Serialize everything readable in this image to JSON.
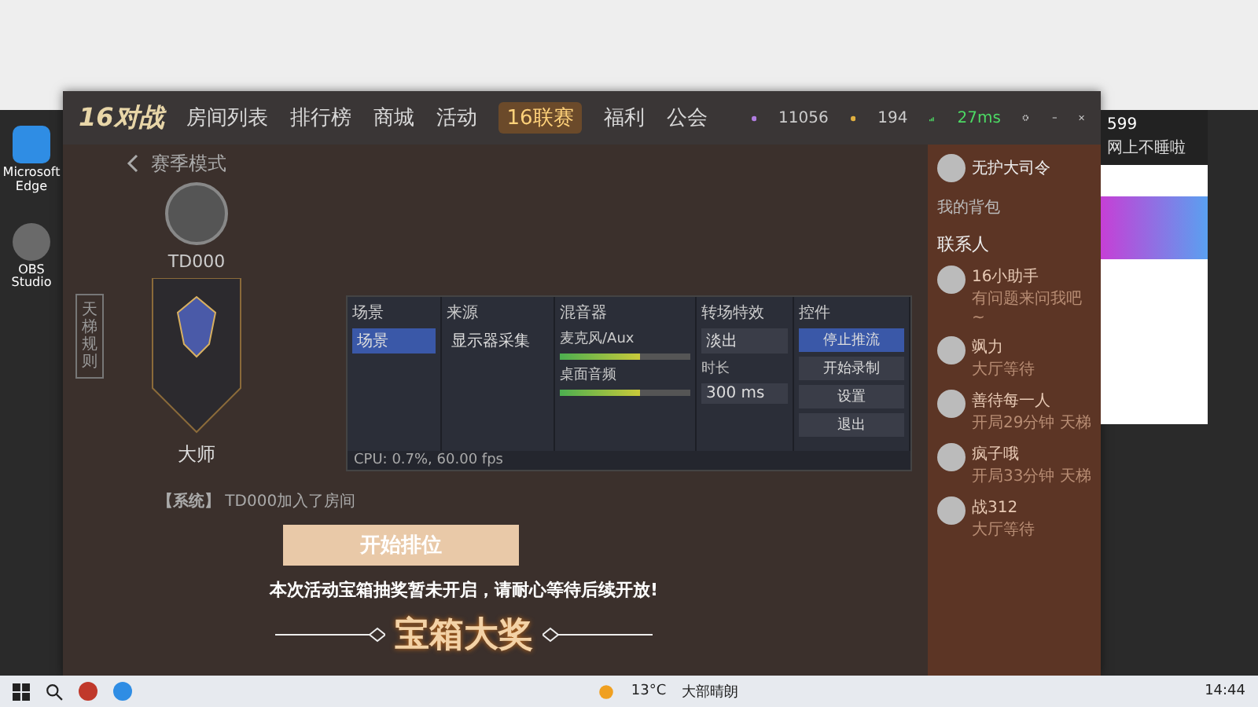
{
  "desktop_icons": [
    {
      "label": "Microsoft Edge",
      "kind": "browser"
    },
    {
      "label": "OBS Studio",
      "kind": "recorder"
    }
  ],
  "game_window": {
    "logo": "16对战",
    "nav": [
      {
        "label": "房间列表",
        "selected": false
      },
      {
        "label": "排行榜",
        "selected": false
      },
      {
        "label": "商城",
        "selected": false
      },
      {
        "label": "活动",
        "selected": false
      },
      {
        "label": "16联赛",
        "selected": true
      },
      {
        "label": "福利",
        "selected": false
      },
      {
        "label": "公会",
        "selected": false
      }
    ],
    "gems": "11056",
    "coins": "194",
    "ping": "27ms",
    "mode_title": "赛季模式",
    "side_tab": "天梯规则",
    "player": {
      "name": "TD000",
      "rank": "大师"
    },
    "system_message": "**【系统】** TD000加入了房间",
    "start_button": "开始排位",
    "notice": "本次活动宝箱抽奖暂未开启，请耐心等待后续开放!",
    "banner": "宝箱大奖",
    "profile": {
      "name": "无护大司令"
    },
    "backpack": "我的背包",
    "contacts_title": "联系人",
    "friends": [
      {
        "name": "16小助手",
        "status": "有问题来问我吧~"
      },
      {
        "name": "飒力",
        "status": "大厅等待"
      },
      {
        "name": "善待每一人",
        "status": "开局29分钟 天梯"
      },
      {
        "name": "疯子哦",
        "status": "开局33分钟 天梯"
      },
      {
        "name": "战312",
        "status": "大厅等待"
      }
    ]
  },
  "obs": {
    "scenes": {
      "title": "场景",
      "items": [
        {
          "label": "场景",
          "selected": true
        }
      ]
    },
    "sources": {
      "title": "来源",
      "items": [
        {
          "label": "显示器采集"
        }
      ]
    },
    "mixer": {
      "title": "混音器",
      "channels": [
        {
          "name": "麦克风/Aux",
          "level": 0.62
        },
        {
          "name": "桌面音频",
          "level": 0.62
        }
      ]
    },
    "transitions": {
      "title": "转场特效",
      "value": "淡出",
      "duration_label": "时长",
      "duration": "300 ms"
    },
    "controls": {
      "title": "控件",
      "buttons": [
        {
          "label": "停止推流",
          "selected": true
        },
        {
          "label": "开始录制",
          "selected": false
        },
        {
          "label": "设置",
          "selected": false
        },
        {
          "label": "退出",
          "selected": false
        }
      ]
    },
    "status": "CPU: 0.7%, 60.00 fps"
  },
  "chat_app": {
    "count": "599",
    "status": "网上不睡啦"
  },
  "taskbar": {
    "temperature": "13°C",
    "weather": "大部晴朗",
    "time": "14:44"
  }
}
